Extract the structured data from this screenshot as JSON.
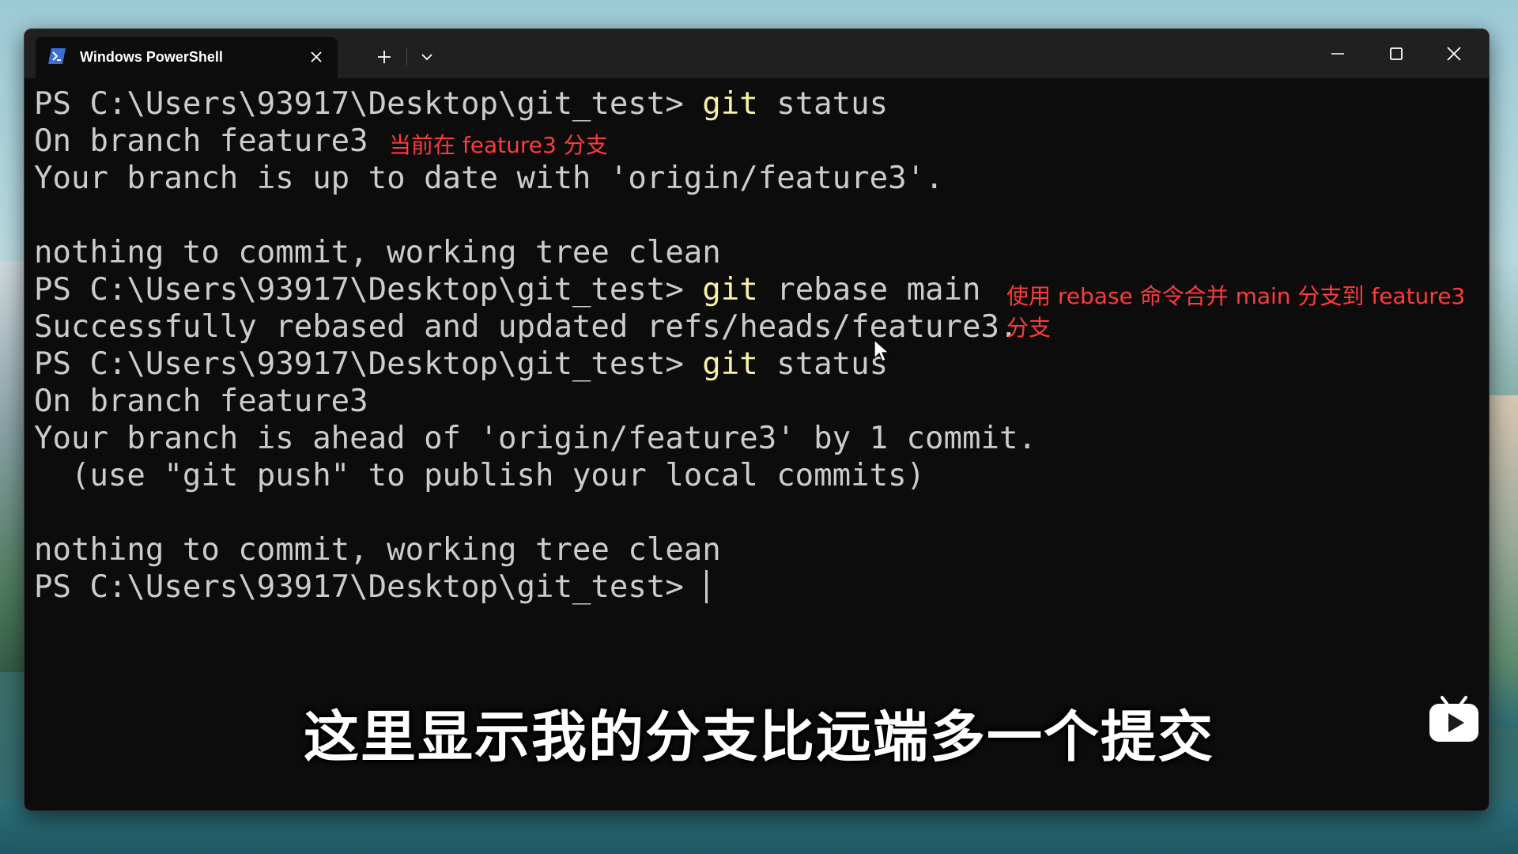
{
  "window": {
    "tab_title": "Windows PowerShell",
    "tab_icon": "powershell-icon",
    "new_tab_icon": "plus-icon",
    "dropdown_icon": "chevron-down-icon",
    "minimize_icon": "minimize-icon",
    "maximize_icon": "maximize-icon",
    "close_icon": "close-icon"
  },
  "terminal": {
    "lines": [
      {
        "prompt": "PS C:\\Users\\93917\\Desktop\\git_test> ",
        "cmd": "git",
        "args": " status"
      },
      {
        "text": "On branch feature3"
      },
      {
        "text": "Your branch is up to date with 'origin/feature3'."
      },
      {
        "text": ""
      },
      {
        "text": "nothing to commit, working tree clean"
      },
      {
        "prompt": "PS C:\\Users\\93917\\Desktop\\git_test> ",
        "cmd": "git",
        "args": " rebase main"
      },
      {
        "text": "Successfully rebased and updated refs/heads/feature3."
      },
      {
        "prompt": "PS C:\\Users\\93917\\Desktop\\git_test> ",
        "cmd": "git",
        "args": " status"
      },
      {
        "text": "On branch feature3"
      },
      {
        "text": "Your branch is ahead of 'origin/feature3' by 1 commit."
      },
      {
        "text": "  (use \"git push\" to publish your local commits)"
      },
      {
        "text": ""
      },
      {
        "text": "nothing to commit, working tree clean"
      },
      {
        "prompt": "PS C:\\Users\\93917\\Desktop\\git_test> "
      }
    ]
  },
  "annotations": {
    "current_branch": "当前在 feature3 分支",
    "rebase_note_line1": "使用 rebase 命令合并 main 分支到 feature3",
    "rebase_note_line2": "分支"
  },
  "subtitle": "这里显示我的分支比远端多一个提交",
  "colors": {
    "terminal_bg": "#0c0c0c",
    "terminal_text": "#cccccc",
    "command_text": "#f9f1a5",
    "annotation_red": "#ff3b3b",
    "titlebar_bg": "#202020"
  }
}
